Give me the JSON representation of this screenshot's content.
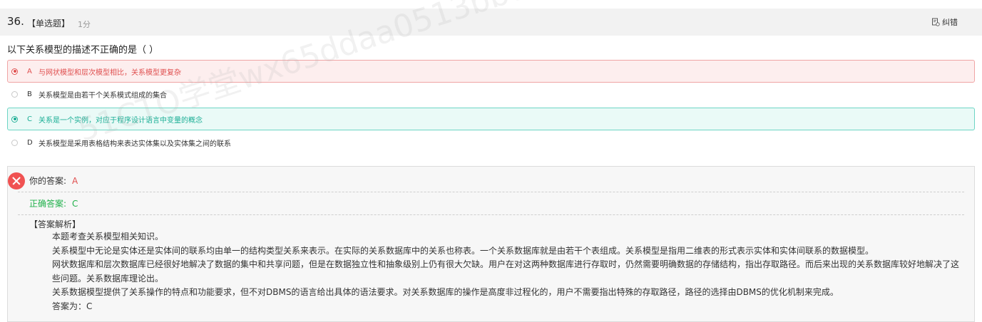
{
  "question": {
    "number": "36.",
    "type": "【单选题】",
    "score": "1分",
    "report_label": "纠错",
    "text": "以下关系模型的描述不正确的是（      ）"
  },
  "options": [
    {
      "letter": "A",
      "text": "与网状模型和层次模型相比，关系模型更复杂",
      "state": "wrong-selected"
    },
    {
      "letter": "B",
      "text": "关系模型是由若干个关系模式组成的集合",
      "state": "normal"
    },
    {
      "letter": "C",
      "text": "关系是一个实例，对应于程序设计语言中变量的概念",
      "state": "correct"
    },
    {
      "letter": "D",
      "text": "关系模型是采用表格结构来表达实体集以及实体集之间的联系",
      "state": "normal"
    }
  ],
  "result": {
    "your_answer_label": "你的答案:",
    "your_answer": "A",
    "correct_label": "正确答案:",
    "correct_answer": "C",
    "analysis_title": "【答案解析】",
    "analysis_lines": [
      "本题考查关系模型相关知识。",
      "关系模型中无论是实体还是实体间的联系均由单一的结构类型关系来表示。在实际的关系数据库中的关系也称表。一个关系数据库就是由若干个表组成。关系模型是指用二维表的形式表示实体和实体间联系的数据模型。",
      "网状数据库和层次数据库已经很好地解决了数据的集中和共享问题，但是在数据独立性和抽象级别上仍有很大欠缺。用户在对这两种数据库进行存取时，仍然需要明确数据的存储结构，指出存取路径。而后来出现的关系数据库较好地解决了这些问题。关系数据库理论出。",
      "关系数据模型提供了关系操作的特点和功能要求，但不对DBMS的语言给出具体的语法要求。对关系数据库的操作是高度非过程化的，用户不需要指出特殊的存取路径，路径的选择由DBMS的优化机制来完成。",
      "答案为：C"
    ]
  },
  "watermark": "51CTO学堂wx65ddaa0513bbd",
  "colors": {
    "wrong": "#e05050",
    "correct": "#1aae95",
    "correct_text": "#22b14c"
  }
}
